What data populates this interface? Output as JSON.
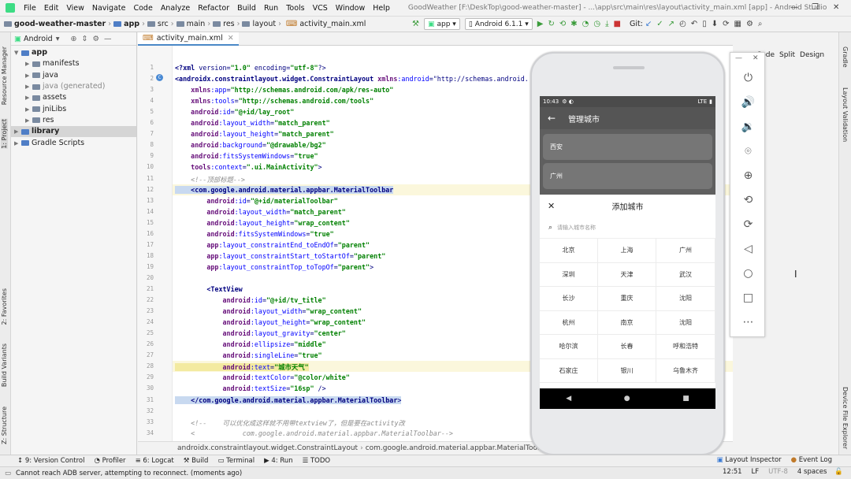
{
  "menubar": {
    "items": [
      "File",
      "Edit",
      "View",
      "Navigate",
      "Code",
      "Analyze",
      "Refactor",
      "Build",
      "Run",
      "Tools",
      "VCS",
      "Window",
      "Help"
    ],
    "window_title": "GoodWeather [F:\\DeskTop\\good-weather-master] - ...\\app\\src\\main\\res\\layout\\activity_main.xml [app] - Android Studio"
  },
  "navbar": {
    "breadcrumbs": [
      "good-weather-master",
      "app",
      "src",
      "main",
      "res",
      "layout",
      "activity_main.xml"
    ],
    "run_config": "app",
    "device": "Android 6.1.1",
    "git_label": "Git:"
  },
  "left_strip": {
    "tabs": [
      "Resource Manager",
      "1: Project",
      "2: Favorites",
      "Build Variants",
      "Z: Structure"
    ]
  },
  "right_strip": {
    "tabs": [
      "Gradle",
      "Layout Validation",
      "Device File Explorer"
    ]
  },
  "project": {
    "view": "Android",
    "tree": [
      {
        "label": "app",
        "bold": true,
        "depth": 0,
        "arrow": "▼"
      },
      {
        "label": "manifests",
        "depth": 1,
        "arrow": "▶"
      },
      {
        "label": "java",
        "depth": 1,
        "arrow": "▶"
      },
      {
        "label": "java (generated)",
        "depth": 1,
        "arrow": "▶",
        "gray": true
      },
      {
        "label": "assets",
        "depth": 1,
        "arrow": "▶"
      },
      {
        "label": "jniLibs",
        "depth": 1,
        "arrow": "▶"
      },
      {
        "label": "res",
        "depth": 1,
        "arrow": "▶"
      },
      {
        "label": "library",
        "depth": 0,
        "arrow": "▶",
        "bold": true,
        "selected": true
      },
      {
        "label": "Gradle Scripts",
        "depth": 0,
        "arrow": "▶"
      }
    ]
  },
  "editor": {
    "tab": "activity_main.xml",
    "view_modes": [
      "Code",
      "Split",
      "Design"
    ],
    "code_lines": [
      "<?xml version=\"1.0\" encoding=\"utf-8\"?>",
      "<androidx.constraintlayout.widget.ConstraintLayout xmlns:android=\"http://schemas.android.",
      "    xmlns:app=\"http://schemas.android.com/apk/res-auto\"",
      "    xmlns:tools=\"http://schemas.android.com/tools\"",
      "    android:id=\"@+id/lay_root\"",
      "    android:layout_width=\"match_parent\"",
      "    android:layout_height=\"match_parent\"",
      "    android:background=\"@drawable/bg2\"",
      "    android:fitsSystemWindows=\"true\"",
      "    tools:context=\".ui.MainActivity\">",
      "    <!--顶部标题-->",
      "    <com.google.android.material.appbar.MaterialToolbar",
      "        android:id=\"@+id/materialToolbar\"",
      "        android:layout_width=\"match_parent\"",
      "        android:layout_height=\"wrap_content\"",
      "        android:fitsSystemWindows=\"true\"",
      "        app:layout_constraintEnd_toEndOf=\"parent\"",
      "        app:layout_constraintStart_toStartOf=\"parent\"",
      "        app:layout_constraintTop_toTopOf=\"parent\">",
      "",
      "        <TextView",
      "            android:id=\"@+id/tv_title\"",
      "            android:layout_width=\"wrap_content\"",
      "            android:layout_height=\"wrap_content\"",
      "            android:layout_gravity=\"center\"",
      "            android:ellipsize=\"middle\"",
      "            android:singleLine=\"true\"",
      "            android:text=\"城市天气\"",
      "            android:textColor=\"@color/white\"",
      "            android:textSize=\"16sp\" />",
      "    </com.google.android.material.appbar.MaterialToolbar>",
      "",
      "    <!--    可以优化成这样就不用带textview了，但是要在activity改",
      "    <            com.google.android.material.appbar.MaterialToolbar-->"
    ],
    "breadcrumb_status": [
      "androidx.constraintlayout.widget.ConstraintLayout",
      "com.google.android.material.appbar.MaterialToolbar"
    ]
  },
  "emulator": {
    "status_time": "10:43",
    "status_right": "LTE",
    "toolbar_title": "管理城市",
    "saved_cities": [
      "西安",
      "广州"
    ],
    "sheet_title": "添加城市",
    "search_placeholder": "请输入城市名称",
    "cities": [
      "北京",
      "上海",
      "广州",
      "深圳",
      "天津",
      "武汉",
      "长沙",
      "重庆",
      "沈阳",
      "杭州",
      "南京",
      "沈阳",
      "哈尔滨",
      "长春",
      "呼和浩特",
      "石家庄",
      "银川",
      "乌鲁木齐"
    ]
  },
  "bottombar": {
    "left": [
      "9: Version Control",
      "Profiler",
      "6: Logcat",
      "Build",
      "Terminal",
      "4: Run",
      "TODO"
    ],
    "right": [
      "Layout Inspector",
      "Event Log"
    ]
  },
  "statusbar": {
    "message": "Cannot reach ADB server, attempting to reconnect. (moments ago)",
    "position": "12:51",
    "line_sep": "LF",
    "encoding": "UTF-8",
    "indent": "4 spaces"
  }
}
